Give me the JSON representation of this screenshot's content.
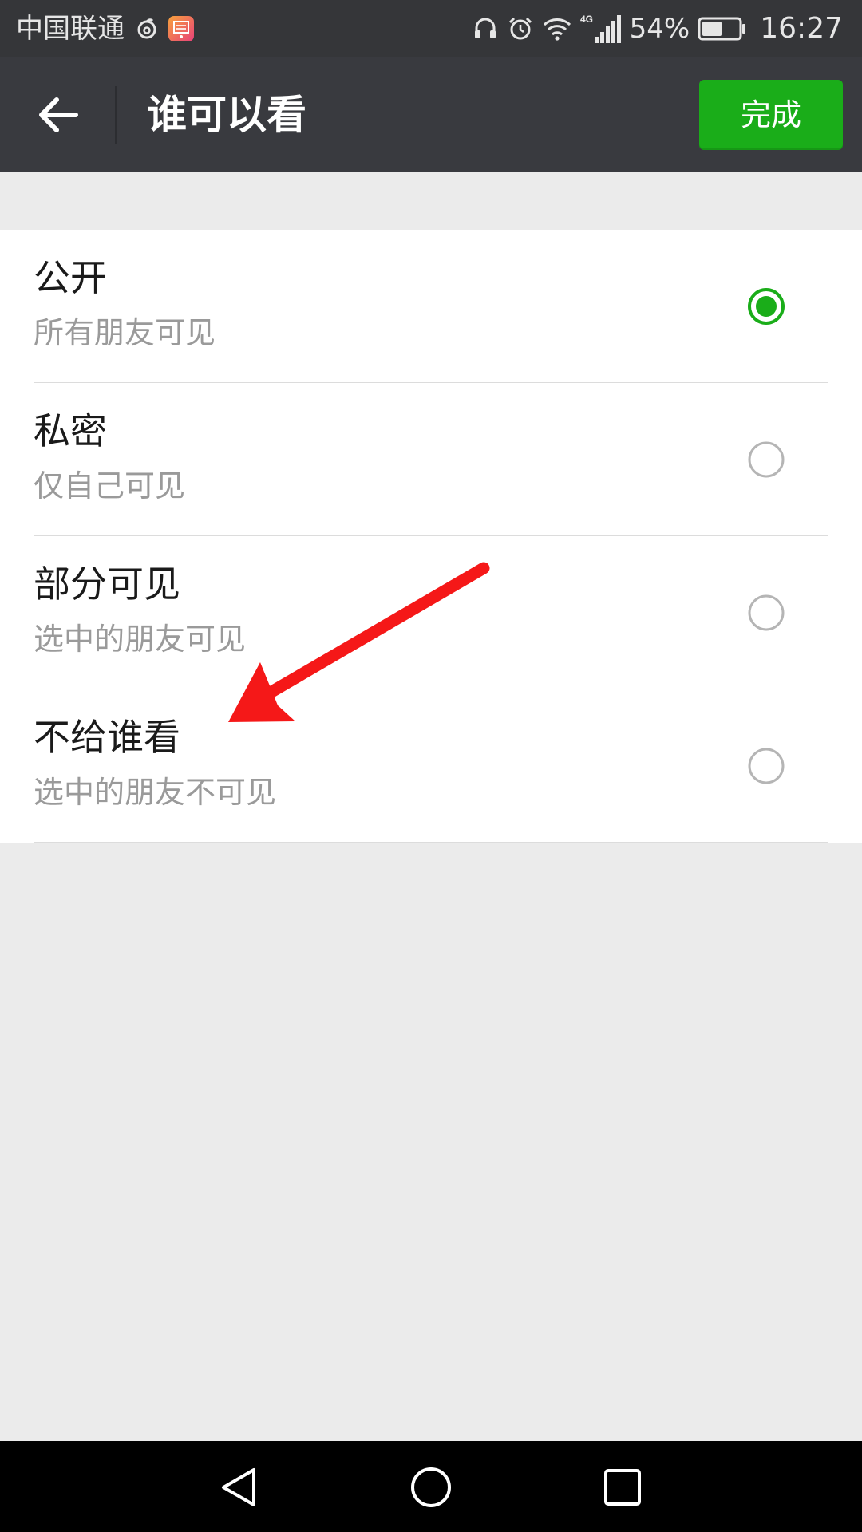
{
  "status_bar": {
    "carrier": "中国联通",
    "battery_percent": "54%",
    "battery_level": 0.54,
    "time": "16:27",
    "network_type": "4G",
    "icons": [
      "netease-music-icon",
      "app-notification-icon",
      "headset-icon",
      "alarm-icon",
      "wifi-icon",
      "signal-icon",
      "battery-icon"
    ]
  },
  "app_bar": {
    "title": "谁可以看",
    "back_icon": "back-arrow-icon",
    "done_label": "完成"
  },
  "options": [
    {
      "label": "公开",
      "description": "所有朋友可见",
      "selected": true
    },
    {
      "label": "私密",
      "description": "仅自己可见",
      "selected": false
    },
    {
      "label": "部分可见",
      "description": "选中的朋友可见",
      "selected": false
    },
    {
      "label": "不给谁看",
      "description": "选中的朋友不可见",
      "selected": false
    }
  ],
  "nav_bar": {
    "icons": [
      "nav-back-icon",
      "nav-home-icon",
      "nav-recents-icon"
    ]
  },
  "colors": {
    "accent_green": "#1aad19",
    "app_bar": "#393a3f",
    "status_bar": "#353639",
    "background": "#ebebeb",
    "annotation_red": "#f51818"
  }
}
